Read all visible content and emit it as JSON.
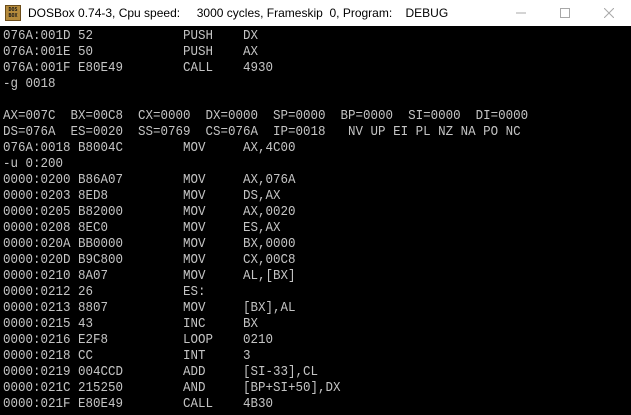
{
  "window": {
    "title": "DOSBox 0.74-3, Cpu speed:     3000 cycles, Frameskip  0, Program:    DEBUG",
    "icon_label_top": "DOS",
    "icon_label_bottom": "BOX",
    "minimize_icon": "minimize-icon",
    "maximize_icon": "maximize-icon",
    "close_icon": "close-icon"
  },
  "console": {
    "lines": [
      "076A:001D 52            PUSH    DX",
      "076A:001E 50            PUSH    AX",
      "076A:001F E80E49        CALL    4930",
      "-g 0018",
      "",
      "AX=007C  BX=00C8  CX=0000  DX=0000  SP=0000  BP=0000  SI=0000  DI=0000",
      "DS=076A  ES=0020  SS=0769  CS=076A  IP=0018   NV UP EI PL NZ NA PO NC",
      "076A:0018 B8004C        MOV     AX,4C00",
      "-u 0:200",
      "0000:0200 B86A07        MOV     AX,076A",
      "0000:0203 8ED8          MOV     DS,AX",
      "0000:0205 B82000        MOV     AX,0020",
      "0000:0208 8EC0          MOV     ES,AX",
      "0000:020A BB0000        MOV     BX,0000",
      "0000:020D B9C800        MOV     CX,00C8",
      "0000:0210 8A07          MOV     AL,[BX]",
      "0000:0212 26            ES:",
      "0000:0213 8807          MOV     [BX],AL",
      "0000:0215 43            INC     BX",
      "0000:0216 E2F8          LOOP    0210",
      "0000:0218 CC            INT     3",
      "0000:0219 004CCD        ADD     [SI-33],CL",
      "0000:021C 215250        AND     [BP+SI+50],DX",
      "0000:021F E80E49        CALL    4B30"
    ]
  }
}
